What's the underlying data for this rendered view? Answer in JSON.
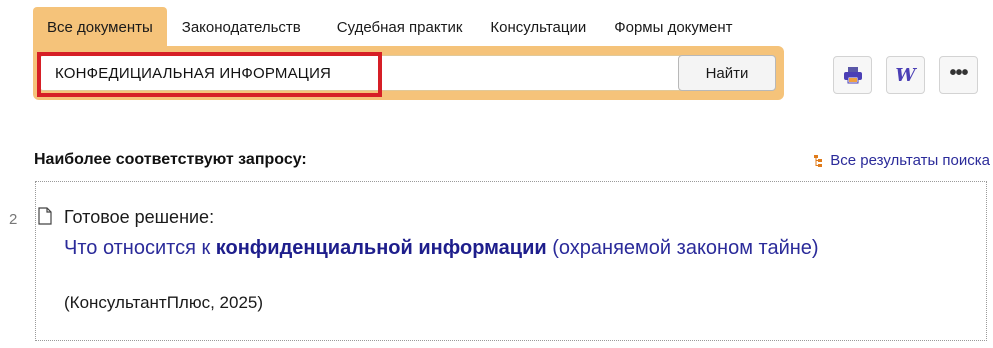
{
  "tabs": [
    {
      "label": "Все документы",
      "active": true
    },
    {
      "label": "Законодательств",
      "active": false
    },
    {
      "label": "Судебная практик",
      "active": false
    },
    {
      "label": "Консультации",
      "active": false
    },
    {
      "label": "Формы документ",
      "active": false
    }
  ],
  "search": {
    "value": "КОНФЕДИЦИАЛЬНАЯ ИНФОРМАЦИЯ",
    "find_label": "Найти"
  },
  "toolbar": {
    "print_icon": "printer-icon",
    "word_icon": "word-export-icon",
    "word_glyph": "W",
    "more_icon": "more-dots-icon",
    "more_glyph": "•••"
  },
  "results": {
    "heading": "Наиболее соответствуют запросу:",
    "all_results_label": "Все результаты поиска",
    "items": [
      {
        "number": "2",
        "type": "Готовое решение:",
        "title_prefix": "Что относится к ",
        "title_bold": "конфиденциальной информации",
        "title_suffix": " (охраняемой законом тайне)",
        "source": "(КонсультантПлюс, 2025)"
      }
    ]
  },
  "colors": {
    "accent": "#f5c37a",
    "link": "#2b2b9a",
    "highlight": "#d61f26"
  }
}
